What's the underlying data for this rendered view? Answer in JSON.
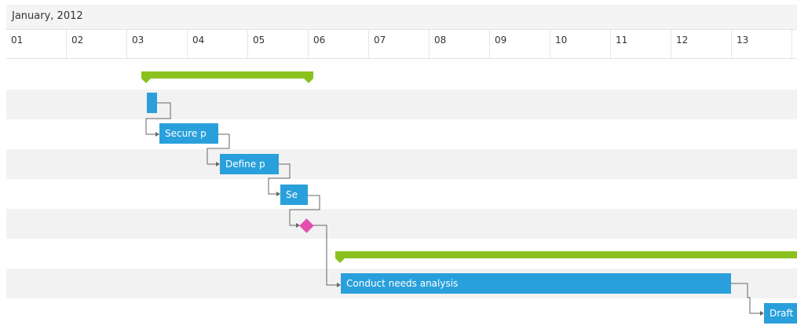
{
  "header": {
    "month_label": "January, 2012",
    "days": [
      "01",
      "02",
      "03",
      "04",
      "05",
      "06",
      "07",
      "08",
      "09",
      "10",
      "11",
      "12",
      "13"
    ]
  },
  "tasks": {
    "secure": "Secure p",
    "define": "Define p",
    "se": "Se",
    "conduct": "Conduct needs analysis",
    "draft": "Draft"
  },
  "colors": {
    "task": "#29a0db",
    "summary": "#8bc11f",
    "milestone": "#e24fae",
    "dependency": "#666666"
  }
}
